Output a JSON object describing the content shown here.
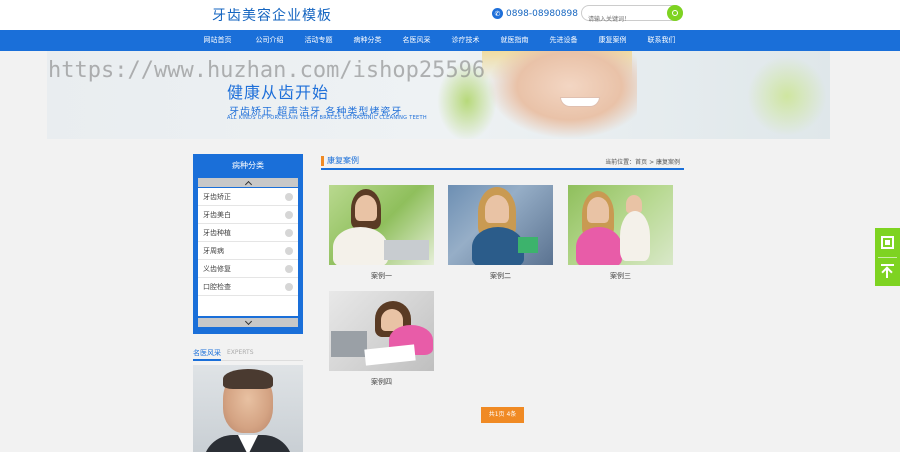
{
  "header": {
    "logo": "牙齿美容企业模板",
    "phone": "0898-08980898",
    "search_placeholder": "请输入关键词！"
  },
  "nav": [
    "网站首页",
    "公司介绍",
    "活动专题",
    "病种分类",
    "名医风采",
    "诊疗技术",
    "就医指南",
    "先进设备",
    "康复案例",
    "联系我们"
  ],
  "banner": {
    "title": "健康从齿开始",
    "subtitle": "牙齿矫正  超声洁牙  各种类型烤瓷牙",
    "english": "ALL KINDS OF PORCELAIN TEETH BRACES ULTRASONIC CLEANING TEETH"
  },
  "watermark": "https://www.huzhan.com/ishop25596",
  "sidebar": {
    "title": "病种分类",
    "items": [
      "牙齿矫正",
      "牙齿美白",
      "牙齿种植",
      "牙周病",
      "义齿修复",
      "口腔检查"
    ]
  },
  "doctors": {
    "title": "名医风采",
    "en": "EXPERTS"
  },
  "main": {
    "title": "康复案例",
    "breadcrumb": "当前位置：首页 > 康复案例",
    "cases": [
      "案例一",
      "案例二",
      "案例三",
      "案例四"
    ],
    "pager": "共1页 4条"
  },
  "colors": {
    "brand": "#1a6fd9",
    "accent": "#f08a24",
    "float": "#7ed321"
  },
  "icons": [
    "phone-icon",
    "search-icon",
    "chevron-up-icon",
    "chevron-down-icon",
    "qrcode-icon",
    "back-to-top-icon"
  ]
}
